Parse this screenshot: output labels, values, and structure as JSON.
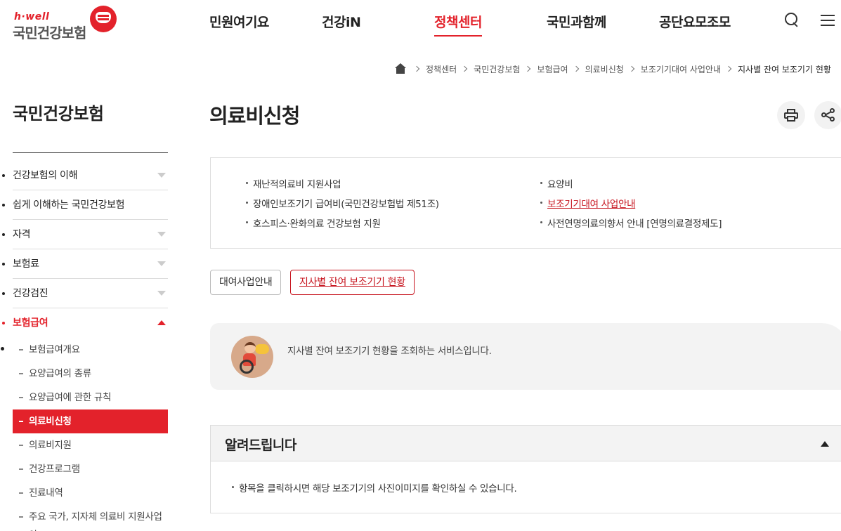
{
  "logo": {
    "small": "h·well",
    "big": "국민건강보험"
  },
  "gnb": [
    "민원여기요",
    "건강iN",
    "정책센터",
    "국민과함께",
    "공단요모조모"
  ],
  "gnb_active": "정책센터",
  "breadcrumb": [
    "정책센터",
    "국민건강보험",
    "보험급여",
    "의료비신청",
    "보조기기대여 사업안내",
    "지사별 잔여 보조기기 현황"
  ],
  "sidebar": {
    "title": "국민건강보험",
    "items": [
      {
        "label": "건강보험의 이해",
        "arrow": true
      },
      {
        "label": "쉽게 이해하는 국민건강보험",
        "arrow": false
      },
      {
        "label": "자격",
        "arrow": true
      },
      {
        "label": "보험료",
        "arrow": true
      },
      {
        "label": "건강검진",
        "arrow": true
      },
      {
        "label": "보험급여",
        "arrow": true,
        "open": true
      }
    ],
    "sub_items": [
      "보험급여개요",
      "요양급여의 종류",
      "요양급여에 관한 규칙",
      "의료비신청",
      "의료비지원",
      "건강프로그램",
      "진료내역",
      "주요 국가, 지자체 의료비 지원사업"
    ],
    "sub_active": "의료비신청",
    "sub_overflow": "안"
  },
  "main": {
    "title": "의료비신청",
    "links_left": [
      "재난적의료비 지원사업",
      "장애인보조기기 급여비(국민건강보험법 제51조)",
      "호스피스·완화의료 건강보험 지원"
    ],
    "links_right": [
      "요양비",
      "보조기기대여 사업안내",
      "사전연명의료의향서 안내 [연명의료결정제도]"
    ],
    "links_right_active": "보조기기대여 사업안내",
    "tabs": [
      "대여사업안내",
      "지사별 잔여 보조기기 현황"
    ],
    "tab_active": "지사별 잔여 보조기기 현황",
    "info_text": "지사별 잔여 보조기기 현황을 조회하는 서비스입니다.",
    "notice_title": "알려드립니다",
    "notice_text": "항목을 클릭하시면 해당 보조기기의 사진이미지를 확인하실 수 있습니다."
  },
  "colors": {
    "accent": "#e3222b",
    "panel": "#f3f3f3"
  }
}
